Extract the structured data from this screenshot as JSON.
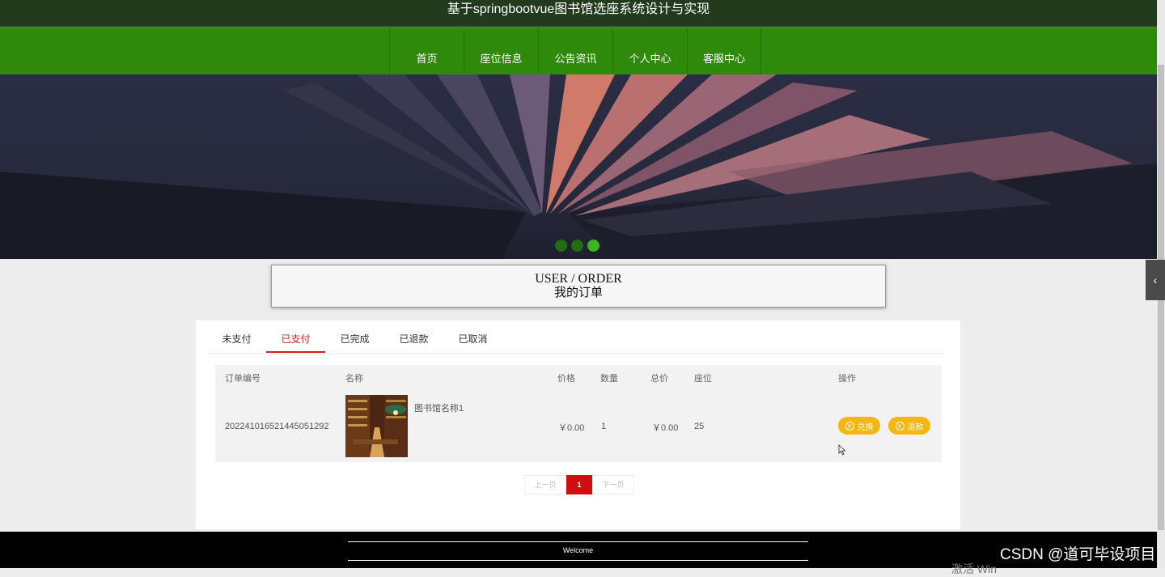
{
  "header": {
    "title": "基于springbootvue图书馆选座系统设计与实现"
  },
  "nav": {
    "items": [
      "首页",
      "座位信息",
      "公告资讯",
      "个人中心",
      "客服中心"
    ]
  },
  "carousel": {
    "slides": 3,
    "active_index": 2
  },
  "section": {
    "title_en": "USER / ORDER",
    "title_cn": "我的订单"
  },
  "tabs": {
    "items": [
      "未支付",
      "已支付",
      "已完成",
      "已退款",
      "已取消"
    ],
    "active_index": 1
  },
  "table": {
    "headers": {
      "order_no": "订单编号",
      "name": "名称",
      "price": "价格",
      "quantity": "数量",
      "total": "总价",
      "seat": "座位",
      "action": "操作"
    },
    "rows": [
      {
        "order_no": "20224101652144505129​2",
        "name": "图书馆名称1",
        "price": "￥0.00",
        "quantity": "1",
        "total": "￥0.00",
        "seat": "25"
      }
    ],
    "buttons": {
      "exchange": "兑换",
      "refund": "退款"
    }
  },
  "pagination": {
    "prev": "上一页",
    "current": "1",
    "next": "下一页"
  },
  "footer": {
    "welcome": "Welcome"
  },
  "watermark": {
    "text": "CSDN @道可毕设项目",
    "partial": "激活 Win"
  },
  "colors": {
    "nav_green": "#2f8a0c",
    "header_dark": "#233b1d",
    "accent_red": "#d42020",
    "button_yellow": "#f3b70f"
  }
}
